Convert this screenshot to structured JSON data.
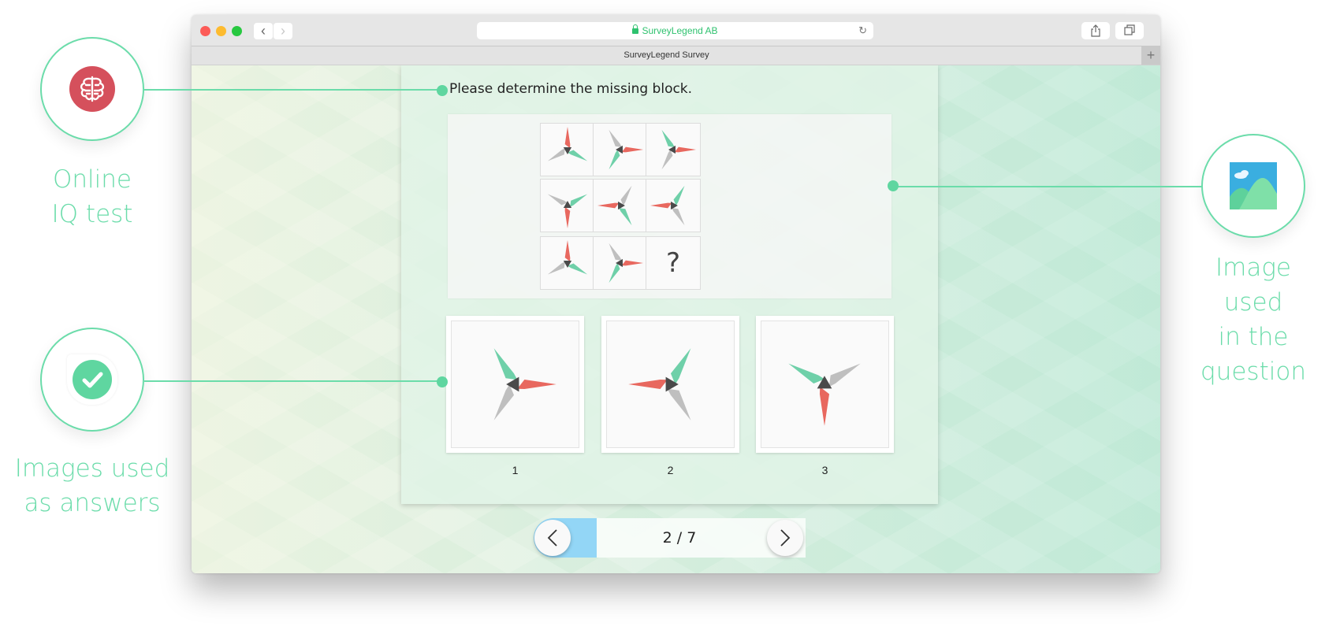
{
  "annotations": [
    {
      "id": "iq",
      "icon": "brain-icon",
      "lines": [
        "Online",
        "IQ test"
      ]
    },
    {
      "id": "answers",
      "icon": "checkmark-icon",
      "lines": [
        "Images used",
        "as answers"
      ]
    },
    {
      "id": "question-image",
      "icon": "image-icon",
      "lines": [
        "Image used",
        "in the",
        "question"
      ]
    }
  ],
  "browser": {
    "url_text": "SurveyLegend AB",
    "tab_title": "SurveyLegend Survey",
    "back_icon": "‹",
    "forward_icon": "›",
    "reload_icon": "↻",
    "new_tab_icon": "+"
  },
  "survey": {
    "question": "Please determine the missing block.",
    "matrix": [
      [
        {
          "red": 0,
          "green": 120,
          "gray": 240
        },
        {
          "red": 90,
          "green": 210,
          "gray": 330
        },
        {
          "red": 90,
          "green": 330,
          "gray": 210
        }
      ],
      [
        {
          "red": 180,
          "green": 60,
          "gray": 300
        },
        {
          "red": 270,
          "green": 150,
          "gray": 30
        },
        {
          "red": 270,
          "green": 30,
          "gray": 150
        }
      ],
      [
        {
          "red": 0,
          "green": 120,
          "gray": 240
        },
        {
          "red": 90,
          "green": 210,
          "gray": 330
        },
        {
          "missing": true,
          "label": "?"
        }
      ]
    ],
    "answers": [
      {
        "label": "1",
        "shape": {
          "red": 90,
          "green": 330,
          "gray": 210
        }
      },
      {
        "label": "2",
        "shape": {
          "red": 270,
          "green": 30,
          "gray": 150
        }
      },
      {
        "label": "3",
        "shape": {
          "red": 180,
          "green": 300,
          "gray": 60
        }
      }
    ],
    "colors": {
      "red": "#e8685f",
      "green": "#6fd0a9",
      "gray": "#bfbfbf",
      "center": "#4a4a4a"
    }
  },
  "pager": {
    "current": 2,
    "total": 7,
    "text": "2 / 7",
    "progress_fraction": 0.2857
  },
  "accent": "#6bdcaa"
}
